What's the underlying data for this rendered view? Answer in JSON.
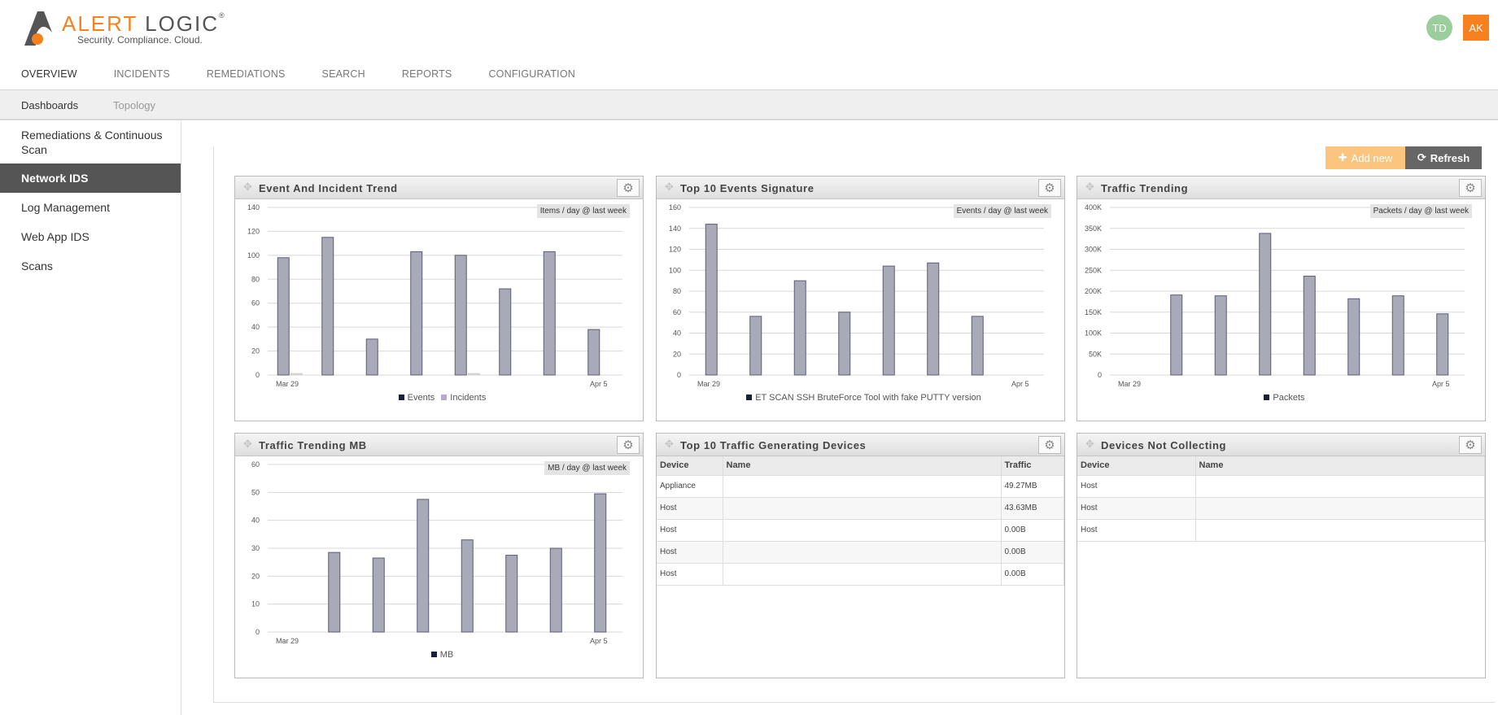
{
  "brand": {
    "name_a": "ALERT",
    "name_b": "LOGIC",
    "reg": "®",
    "tagline": "Security. Compliance. Cloud."
  },
  "user": {
    "avatar1": "TD",
    "avatar2": "AK"
  },
  "main_nav": [
    "OVERVIEW",
    "INCIDENTS",
    "REMEDIATIONS",
    "SEARCH",
    "REPORTS",
    "CONFIGURATION"
  ],
  "sub_nav": {
    "active": "Dashboards",
    "other": "Topology"
  },
  "sidebar": {
    "items": [
      "Remediations & Continuous",
      "Scan",
      "Network IDS",
      "Log Management",
      "Web App IDS",
      "Scans"
    ]
  },
  "toolbar": {
    "add_label": "Add new",
    "refresh_label": "Refresh"
  },
  "widgets": {
    "w1": {
      "title": "Event And Incident Trend",
      "unit": "Items / day @ last week"
    },
    "w2": {
      "title": "Top 10 Events Signature",
      "unit": "Events / day @ last week"
    },
    "w3": {
      "title": "Traffic Trending",
      "unit": "Packets / day @ last week"
    },
    "w4": {
      "title": "Traffic Trending MB",
      "unit": "MB / day @ last week"
    },
    "w5": {
      "title": "Top 10 Traffic Generating Devices",
      "columns": [
        "Device",
        "Name",
        "Traffic"
      ],
      "rows": [
        [
          "Appliance",
          "",
          "49.27MB"
        ],
        [
          "Host",
          "",
          "43.63MB"
        ],
        [
          "Host",
          "",
          "0.00B"
        ],
        [
          "Host",
          "",
          "0.00B"
        ],
        [
          "Host",
          "",
          "0.00B"
        ]
      ]
    },
    "w6": {
      "title": "Devices Not Collecting",
      "columns": [
        "Device",
        "Name"
      ],
      "rows": [
        [
          "Host",
          ""
        ],
        [
          "Host",
          ""
        ],
        [
          "Host",
          ""
        ]
      ]
    }
  },
  "chart_data": [
    {
      "type": "bar",
      "x_labels": [
        "Mar 29",
        "Apr 5"
      ],
      "ylim": [
        0,
        140
      ],
      "yticks": [
        0,
        20,
        40,
        60,
        80,
        100,
        120,
        140
      ],
      "series": [
        {
          "name": "Events",
          "values": [
            98,
            115,
            30,
            103,
            100,
            72,
            103,
            38
          ]
        },
        {
          "name": "Incidents",
          "values": [
            1,
            0,
            0,
            0,
            1,
            0,
            0,
            0
          ]
        }
      ]
    },
    {
      "type": "bar",
      "x_labels": [
        "Mar 29",
        "Apr 5"
      ],
      "ylim": [
        0,
        160
      ],
      "yticks": [
        0,
        20,
        40,
        60,
        80,
        100,
        120,
        140,
        160
      ],
      "series": [
        {
          "name": "ET SCAN SSH BruteForce Tool with fake PUTTY version",
          "values": [
            144,
            56,
            90,
            60,
            104,
            107,
            56,
            0
          ]
        }
      ]
    },
    {
      "type": "bar",
      "x_labels": [
        "Mar 29",
        "Apr 5"
      ],
      "ylim": [
        0,
        400000
      ],
      "yticks": [
        "0",
        "50K",
        "100K",
        "150K",
        "200K",
        "250K",
        "300K",
        "350K",
        "400K"
      ],
      "series": [
        {
          "name": "Packets",
          "values": [
            0,
            191000,
            189000,
            338000,
            236000,
            182000,
            189000,
            146000
          ]
        }
      ]
    },
    {
      "type": "bar",
      "x_labels": [
        "Mar 29",
        "Apr 5"
      ],
      "ylim": [
        0,
        60
      ],
      "yticks": [
        0,
        10,
        20,
        30,
        40,
        50,
        60
      ],
      "series": [
        {
          "name": "MB",
          "values": [
            0,
            28.5,
            26.5,
            47.5,
            33,
            27.5,
            30,
            49.5
          ]
        }
      ]
    }
  ]
}
